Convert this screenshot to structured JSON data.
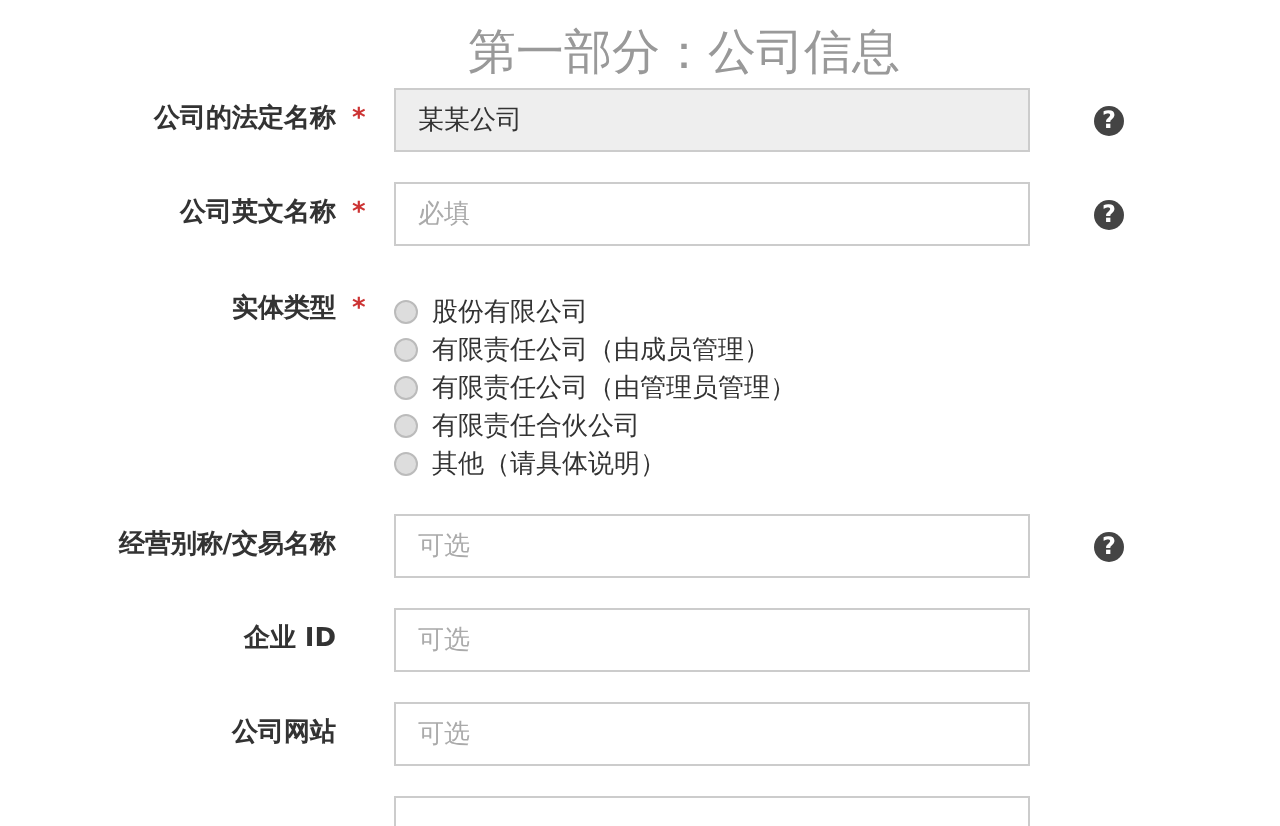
{
  "title": "第一部分：公司信息",
  "fields": [
    {
      "kind": "input",
      "label": "公司的法定名称",
      "required_mark": "*",
      "value": "某某公司",
      "disabled": true,
      "help": "?"
    },
    {
      "kind": "input",
      "label": "公司英文名称",
      "required_mark": "*",
      "placeholder": "必填",
      "disabled": false,
      "help": "?"
    },
    {
      "kind": "radio",
      "label": "实体类型",
      "required_mark": "*",
      "options": [
        {
          "label": "股份有限公司",
          "selected": false
        },
        {
          "label": "有限责任公司（由成员管理）",
          "selected": false
        },
        {
          "label": "有限责任公司（由管理员管理）",
          "selected": false
        },
        {
          "label": "有限责任合伙公司",
          "selected": false
        },
        {
          "label": "其他（请具体说明）",
          "selected": false
        }
      ]
    },
    {
      "kind": "input",
      "label": "经营别称/交易名称",
      "placeholder": "可选",
      "disabled": false,
      "help": "?"
    },
    {
      "kind": "input",
      "label": "企业 ID",
      "placeholder": "可选",
      "disabled": false
    },
    {
      "kind": "input",
      "label": "公司网站",
      "placeholder": "可选",
      "disabled": false
    },
    {
      "kind": "input",
      "disabled": false
    }
  ]
}
